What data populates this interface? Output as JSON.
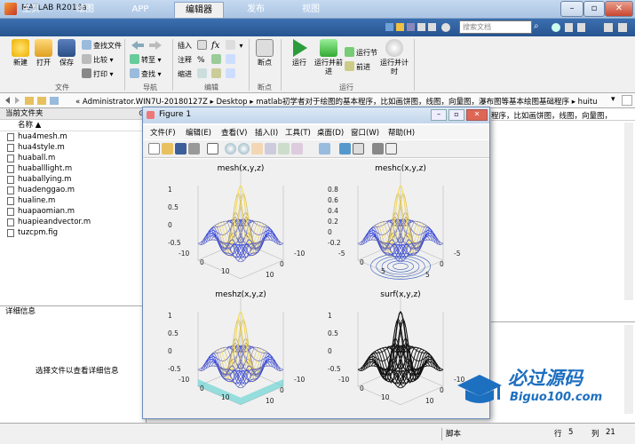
{
  "window": {
    "title": "MATLAB R2018a",
    "min": "–",
    "max": "▫",
    "close": "✕"
  },
  "tabs": [
    {
      "label": "主页"
    },
    {
      "label": "绘图"
    },
    {
      "label": "APP"
    },
    {
      "label": "编辑器"
    },
    {
      "label": "发布"
    },
    {
      "label": "视图"
    }
  ],
  "search_placeholder": "搜索文档",
  "toolstrip": {
    "file": {
      "new": "新建",
      "open": "打开",
      "save": "保存",
      "find_files": "查找文件",
      "compare": "比较",
      "print": "打印",
      "group": "文件"
    },
    "nav": {
      "goto": "转至",
      "find": "查找",
      "group": "导航"
    },
    "edit": {
      "insert": "插入",
      "comment": "注释",
      "indent": "缩进",
      "fx": "fx",
      "group": "编辑"
    },
    "breakpoint": {
      "label": "断点",
      "group": "断点"
    },
    "run": {
      "run": "运行",
      "run_advance": "运行并前进",
      "run_section": "运行节",
      "advance": "前进",
      "run_time": "运行并计时",
      "group": "运行"
    }
  },
  "path": "« Administrator.WIN7U-20180127Z ▸ Desktop ▸ matlab初学者对于绘图的基本程序，比如画饼图，线图，向量图，瀑布图等基本绘图基础程序 ▸ huitu",
  "file_panel": {
    "title": "当前文件夹",
    "column": "名称 ▲",
    "files": [
      "hua4mesh.m",
      "hua4style.m",
      "huaball.m",
      "huaballlight.m",
      "huaballying.m",
      "huadenggao.m",
      "hualine.m",
      "huapaomian.m",
      "huapieandvector.m",
      "tuzcpm.fig"
    ]
  },
  "detail_panel": {
    "title": "详细信息",
    "message": "选择文件以查看详细信息"
  },
  "right_panel_text": "程序，比如画饼图，线图，向量图，",
  "figure": {
    "title": "Figure 1",
    "menus": [
      "文件(F)",
      "编辑(E)",
      "查看(V)",
      "插入(I)",
      "工具(T)",
      "桌面(D)",
      "窗口(W)",
      "帮助(H)"
    ],
    "plots": [
      {
        "title": "mesh(x,y,z)",
        "zticks": [
          "1",
          "0.5",
          "0",
          "-0.5"
        ],
        "xticks": [
          "-10",
          "0",
          "10"
        ],
        "yticks": [
          "10",
          "0",
          "-10"
        ]
      },
      {
        "title": "meshc(x,y,z)",
        "zticks": [
          "0.8",
          "0.6",
          "0.4",
          "0.2",
          "0",
          "-0.2"
        ],
        "xticks": [
          "-5",
          "0",
          "5"
        ],
        "yticks": [
          "5",
          "0",
          "-5"
        ]
      },
      {
        "title": "meshz(x,y,z)",
        "zticks": [
          "1",
          "0.5",
          "0",
          "-0.5"
        ],
        "xticks": [
          "-10",
          "0",
          "10"
        ],
        "yticks": [
          "10",
          "0",
          "-10"
        ]
      },
      {
        "title": "surf(x,y,z)",
        "zticks": [
          "1",
          "0.5",
          "0",
          "-0.5"
        ],
        "xticks": [
          "-10",
          "0",
          "10"
        ],
        "yticks": [
          "10",
          "0",
          "-10"
        ]
      }
    ]
  },
  "status": {
    "script": "脚本",
    "row_label": "行",
    "row": "5",
    "col_label": "列",
    "col": "21"
  },
  "watermark": {
    "cn": "必过源码",
    "en": "Biguo100.com"
  },
  "colors": {
    "tab_bg": "#27548f",
    "accent": "#3c6fb0"
  }
}
